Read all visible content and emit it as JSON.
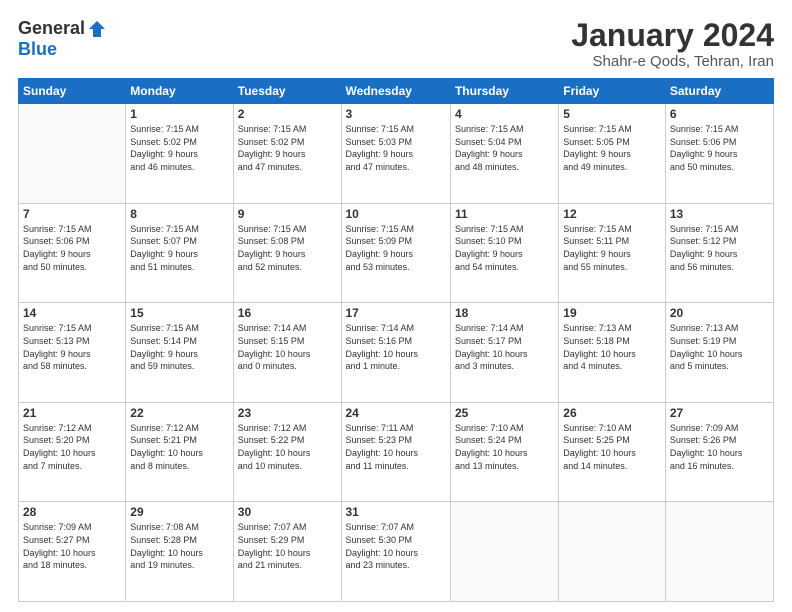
{
  "logo": {
    "general": "General",
    "blue": "Blue"
  },
  "title": "January 2024",
  "subtitle": "Shahr-e Qods, Tehran, Iran",
  "days_header": [
    "Sunday",
    "Monday",
    "Tuesday",
    "Wednesday",
    "Thursday",
    "Friday",
    "Saturday"
  ],
  "weeks": [
    [
      {
        "day": "",
        "info": ""
      },
      {
        "day": "1",
        "info": "Sunrise: 7:15 AM\nSunset: 5:02 PM\nDaylight: 9 hours\nand 46 minutes."
      },
      {
        "day": "2",
        "info": "Sunrise: 7:15 AM\nSunset: 5:02 PM\nDaylight: 9 hours\nand 47 minutes."
      },
      {
        "day": "3",
        "info": "Sunrise: 7:15 AM\nSunset: 5:03 PM\nDaylight: 9 hours\nand 47 minutes."
      },
      {
        "day": "4",
        "info": "Sunrise: 7:15 AM\nSunset: 5:04 PM\nDaylight: 9 hours\nand 48 minutes."
      },
      {
        "day": "5",
        "info": "Sunrise: 7:15 AM\nSunset: 5:05 PM\nDaylight: 9 hours\nand 49 minutes."
      },
      {
        "day": "6",
        "info": "Sunrise: 7:15 AM\nSunset: 5:06 PM\nDaylight: 9 hours\nand 50 minutes."
      }
    ],
    [
      {
        "day": "7",
        "info": "Sunrise: 7:15 AM\nSunset: 5:06 PM\nDaylight: 9 hours\nand 50 minutes."
      },
      {
        "day": "8",
        "info": "Sunrise: 7:15 AM\nSunset: 5:07 PM\nDaylight: 9 hours\nand 51 minutes."
      },
      {
        "day": "9",
        "info": "Sunrise: 7:15 AM\nSunset: 5:08 PM\nDaylight: 9 hours\nand 52 minutes."
      },
      {
        "day": "10",
        "info": "Sunrise: 7:15 AM\nSunset: 5:09 PM\nDaylight: 9 hours\nand 53 minutes."
      },
      {
        "day": "11",
        "info": "Sunrise: 7:15 AM\nSunset: 5:10 PM\nDaylight: 9 hours\nand 54 minutes."
      },
      {
        "day": "12",
        "info": "Sunrise: 7:15 AM\nSunset: 5:11 PM\nDaylight: 9 hours\nand 55 minutes."
      },
      {
        "day": "13",
        "info": "Sunrise: 7:15 AM\nSunset: 5:12 PM\nDaylight: 9 hours\nand 56 minutes."
      }
    ],
    [
      {
        "day": "14",
        "info": "Sunrise: 7:15 AM\nSunset: 5:13 PM\nDaylight: 9 hours\nand 58 minutes."
      },
      {
        "day": "15",
        "info": "Sunrise: 7:15 AM\nSunset: 5:14 PM\nDaylight: 9 hours\nand 59 minutes."
      },
      {
        "day": "16",
        "info": "Sunrise: 7:14 AM\nSunset: 5:15 PM\nDaylight: 10 hours\nand 0 minutes."
      },
      {
        "day": "17",
        "info": "Sunrise: 7:14 AM\nSunset: 5:16 PM\nDaylight: 10 hours\nand 1 minute."
      },
      {
        "day": "18",
        "info": "Sunrise: 7:14 AM\nSunset: 5:17 PM\nDaylight: 10 hours\nand 3 minutes."
      },
      {
        "day": "19",
        "info": "Sunrise: 7:13 AM\nSunset: 5:18 PM\nDaylight: 10 hours\nand 4 minutes."
      },
      {
        "day": "20",
        "info": "Sunrise: 7:13 AM\nSunset: 5:19 PM\nDaylight: 10 hours\nand 5 minutes."
      }
    ],
    [
      {
        "day": "21",
        "info": "Sunrise: 7:12 AM\nSunset: 5:20 PM\nDaylight: 10 hours\nand 7 minutes."
      },
      {
        "day": "22",
        "info": "Sunrise: 7:12 AM\nSunset: 5:21 PM\nDaylight: 10 hours\nand 8 minutes."
      },
      {
        "day": "23",
        "info": "Sunrise: 7:12 AM\nSunset: 5:22 PM\nDaylight: 10 hours\nand 10 minutes."
      },
      {
        "day": "24",
        "info": "Sunrise: 7:11 AM\nSunset: 5:23 PM\nDaylight: 10 hours\nand 11 minutes."
      },
      {
        "day": "25",
        "info": "Sunrise: 7:10 AM\nSunset: 5:24 PM\nDaylight: 10 hours\nand 13 minutes."
      },
      {
        "day": "26",
        "info": "Sunrise: 7:10 AM\nSunset: 5:25 PM\nDaylight: 10 hours\nand 14 minutes."
      },
      {
        "day": "27",
        "info": "Sunrise: 7:09 AM\nSunset: 5:26 PM\nDaylight: 10 hours\nand 16 minutes."
      }
    ],
    [
      {
        "day": "28",
        "info": "Sunrise: 7:09 AM\nSunset: 5:27 PM\nDaylight: 10 hours\nand 18 minutes."
      },
      {
        "day": "29",
        "info": "Sunrise: 7:08 AM\nSunset: 5:28 PM\nDaylight: 10 hours\nand 19 minutes."
      },
      {
        "day": "30",
        "info": "Sunrise: 7:07 AM\nSunset: 5:29 PM\nDaylight: 10 hours\nand 21 minutes."
      },
      {
        "day": "31",
        "info": "Sunrise: 7:07 AM\nSunset: 5:30 PM\nDaylight: 10 hours\nand 23 minutes."
      },
      {
        "day": "",
        "info": ""
      },
      {
        "day": "",
        "info": ""
      },
      {
        "day": "",
        "info": ""
      }
    ]
  ]
}
